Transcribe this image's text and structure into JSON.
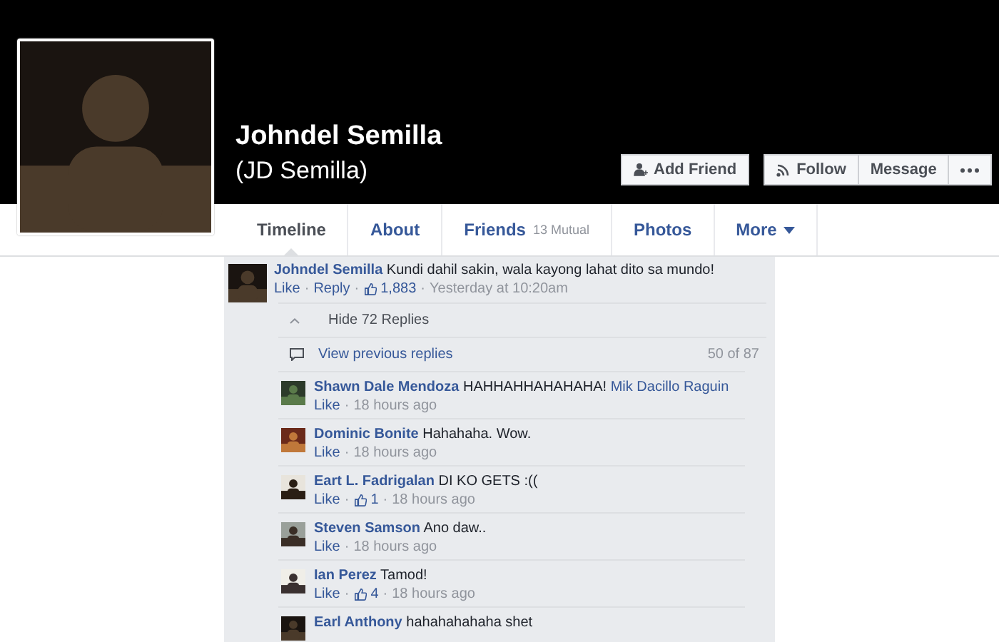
{
  "profile": {
    "name": "Johndel Semilla",
    "alternate_name": "(JD Semilla)"
  },
  "actions": [
    {
      "kind": "add-friend",
      "label": "Add Friend"
    },
    {
      "kind": "follow",
      "label": "Follow"
    },
    {
      "kind": "plain",
      "label": "Message"
    },
    {
      "kind": "more"
    }
  ],
  "tabs": [
    {
      "label": "Timeline",
      "selected": true
    },
    {
      "label": "About",
      "selected": false
    },
    {
      "label": "Friends",
      "badge": "13 Mutual",
      "selected": false
    },
    {
      "label": "Photos",
      "selected": false
    },
    {
      "label": "More",
      "has_menu": true,
      "selected": false
    }
  ],
  "separator": "·",
  "comment": {
    "author": "Johndel Semilla",
    "text": "Kundi dahil sakin, wala kayong lahat dito sa mundo!",
    "meta": [
      {
        "kind": "link",
        "text": "Like"
      },
      {
        "kind": "link",
        "text": "Reply"
      },
      {
        "kind": "likes",
        "text": "1,883"
      },
      {
        "kind": "time",
        "text": "Yesterday at 10:20am"
      }
    ]
  },
  "hide_replies": "Hide 72 Replies",
  "previous_replies": {
    "label": "View previous replies",
    "count": "50 of 87"
  },
  "replies": [
    {
      "author": "Shawn Dale Mendoza",
      "text": "HAHHAHHAHAHAHA!",
      "mention": "Mik Dacillo Raguin",
      "meta": [
        {
          "kind": "link",
          "text": "Like"
        },
        {
          "kind": "time",
          "text": "18 hours ago"
        }
      ]
    },
    {
      "author": "Dominic Bonite",
      "text": "Hahahaha. Wow.",
      "meta": [
        {
          "kind": "link",
          "text": "Like"
        },
        {
          "kind": "time",
          "text": "18 hours ago"
        }
      ]
    },
    {
      "author": "Eart L. Fadrigalan",
      "text": "DI KO GETS :((",
      "meta": [
        {
          "kind": "link",
          "text": "Like"
        },
        {
          "kind": "likes",
          "text": "1"
        },
        {
          "kind": "time",
          "text": "18 hours ago"
        }
      ]
    },
    {
      "author": "Steven Samson",
      "text": "Ano daw..",
      "meta": [
        {
          "kind": "link",
          "text": "Like"
        },
        {
          "kind": "time",
          "text": "18 hours ago"
        }
      ]
    },
    {
      "author": "Ian Perez",
      "text": "Tamod!",
      "meta": [
        {
          "kind": "link",
          "text": "Like"
        },
        {
          "kind": "likes",
          "text": "4"
        },
        {
          "kind": "time",
          "text": "18 hours ago"
        }
      ]
    },
    {
      "author": "Earl Anthony",
      "text": "hahahahahaha shet"
    }
  ]
}
